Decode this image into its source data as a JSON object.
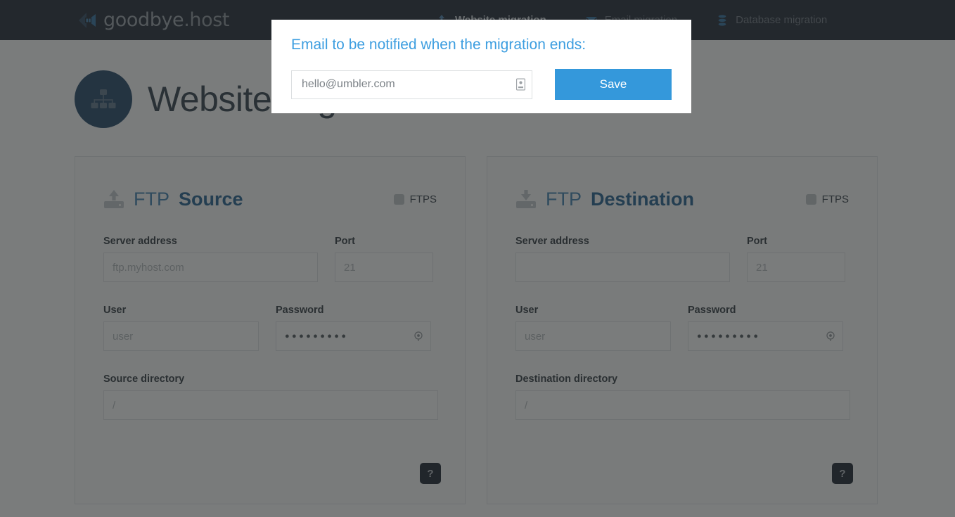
{
  "topbar": {
    "logo_text_main": "goodbye",
    "logo_text_suffix": ".host",
    "nav": [
      {
        "label": "Website migration",
        "icon": "upload-icon",
        "active": true
      },
      {
        "label": "Email migration",
        "icon": "envelope-icon",
        "active": false
      },
      {
        "label": "Database migration",
        "icon": "database-icon",
        "active": false
      }
    ]
  },
  "page": {
    "title": "Website migration",
    "title_icon": "sitemap-icon"
  },
  "colors": {
    "header_bg": "#1b2230",
    "accent_blue": "#3498db",
    "panel_title_blue": "#3d7eb0",
    "panel_title_bold_blue": "#1d5c8e",
    "modal_title_blue": "#3d9ee0",
    "page_icon_circle": "#1d4265",
    "help_button_bg": "#151d2a",
    "dim_overlay": "rgba(40,44,44,0.62)"
  },
  "panels": [
    {
      "icon": "upload-icon",
      "title_prefix": "FTP",
      "title_bold": "Source",
      "ftps_label": "FTPS",
      "ftps_checked": false,
      "server_label": "Server address",
      "server_placeholder": "ftp.myhost.com",
      "server_value": "",
      "port_label": "Port",
      "port_placeholder": "21",
      "port_value": "",
      "user_label": "User",
      "user_placeholder": "user",
      "user_value": "",
      "password_label": "Password",
      "password_dots": "●●●●●●●●●",
      "directory_label": "Source directory",
      "directory_placeholder": "/",
      "directory_value": "",
      "help_label": "?"
    },
    {
      "icon": "download-icon",
      "title_prefix": "FTP",
      "title_bold": "Destination",
      "ftps_label": "FTPS",
      "ftps_checked": false,
      "server_label": "Server address",
      "server_placeholder": "",
      "server_value": "",
      "port_label": "Port",
      "port_placeholder": "21",
      "port_value": "",
      "user_label": "User",
      "user_placeholder": "user",
      "user_value": "",
      "password_label": "Password",
      "password_dots": "●●●●●●●●●",
      "directory_label": "Destination directory",
      "directory_placeholder": "/",
      "directory_value": "",
      "help_label": "?"
    }
  ],
  "modal": {
    "title": "Email to be notified when the migration ends:",
    "email_placeholder": "hello@umbler.com",
    "email_value": "",
    "email_icon": "contact-card-icon",
    "save_label": "Save"
  }
}
